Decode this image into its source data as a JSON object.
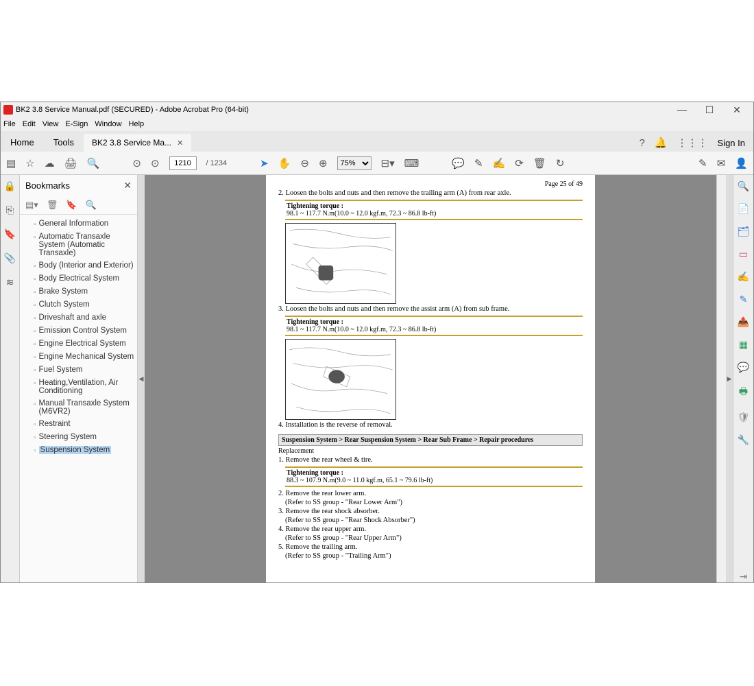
{
  "titlebar": {
    "title": "BK2 3.8 Service Manual.pdf (SECURED) - Adobe Acrobat Pro (64-bit)"
  },
  "menubar": {
    "items": [
      "File",
      "Edit",
      "View",
      "E-Sign",
      "Window",
      "Help"
    ]
  },
  "tabs": {
    "home": "Home",
    "tools": "Tools",
    "doc": "BK2 3.8 Service Ma...",
    "signin": "Sign In"
  },
  "toolbar": {
    "page_current": "1210",
    "page_total": "/ 1234",
    "zoom": "75%"
  },
  "bookmarks": {
    "title": "Bookmarks",
    "items": [
      {
        "label": "General Information"
      },
      {
        "label": "Automatic Transaxle System (Automatic Transaxle)"
      },
      {
        "label": "Body (Interior and Exterior)"
      },
      {
        "label": "Body Electrical System"
      },
      {
        "label": "Brake System"
      },
      {
        "label": "Clutch System"
      },
      {
        "label": "Driveshaft and axle"
      },
      {
        "label": "Emission Control System"
      },
      {
        "label": "Engine Electrical System"
      },
      {
        "label": "Engine Mechanical System"
      },
      {
        "label": "Fuel System"
      },
      {
        "label": "Heating,Ventilation, Air Conditioning"
      },
      {
        "label": "Manual Transaxle System (M6VR2)"
      },
      {
        "label": "Restraint"
      },
      {
        "label": "Steering System"
      },
      {
        "label": "Suspension System",
        "selected": true
      }
    ]
  },
  "document": {
    "pagenum": "Page 25 of 49",
    "step2": "2. Loosen the bolts and nuts and then remove the trailing arm (A) from rear axle.",
    "torque1_title": "Tightening torque :",
    "torque1_val": "98.1 ~ 117.7 N.m(10.0 ~ 12.0 kgf.m, 72.3 ~ 86.8 lb-ft)",
    "step3": "3. Loosen the bolts and nuts and then remove the assist arm (A) from sub frame.",
    "torque2_title": "Tightening torque :",
    "torque2_val": "98.1 ~ 117.7 N.m(10.0 ~ 12.0 kgf.m, 72.3 ~ 86.8 lb-ft)",
    "step4": "4. Installation is the reverse of removal.",
    "breadcrumb": "Suspension System > Rear Suspension System > Rear Sub Frame > Repair procedures",
    "replacement": "Replacement",
    "r_step1": "1. Remove the rear wheel & tire.",
    "torque3_title": "Tightening torque :",
    "torque3_val": "88.3 ~ 107.9 N.m(9.0 ~ 11.0 kgf.m, 65.1 ~ 79.6 lb-ft)",
    "r_step2": "2. Remove the rear lower arm.",
    "r_step2_ref": "(Refer to SS group - \"Rear Lower Arm\")",
    "r_step3": "3. Remove the rear shock absorber.",
    "r_step3_ref": "(Refer to SS group - \"Rear Shock Absorber\")",
    "r_step4": "4. Remove the rear upper arm.",
    "r_step4_ref": "(Refer to SS group - \"Rear Upper Arm\")",
    "r_step5": "5. Remove the trailing arm.",
    "r_step5_ref": "(Refer to SS group - \"Trailing Arm\")"
  }
}
